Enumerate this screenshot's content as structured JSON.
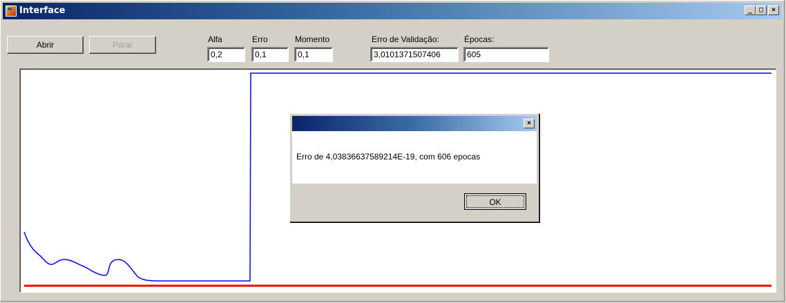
{
  "window": {
    "title": "Interface",
    "controls": {
      "minimize": "_",
      "maximize": "□",
      "close": "×"
    }
  },
  "toolbar": {
    "open_label": "Abrir",
    "stop_label": "Parar"
  },
  "params": {
    "alfa": {
      "label": "Alfa",
      "value": "0,2"
    },
    "erro": {
      "label": "Erro",
      "value": "0,1"
    },
    "momento": {
      "label": "Momento",
      "value": "0,1"
    },
    "erro_validacao": {
      "label": "Erro de Validação:",
      "value": "3,0101371507406"
    },
    "epocas": {
      "label": "Épocas:",
      "value": "605"
    }
  },
  "dialog": {
    "message": "Erro de 4,03836637589214E-19, com 606 epocas",
    "ok_label": "OK",
    "close": "×"
  },
  "colors": {
    "title_start": "#0a246a",
    "title_end": "#a6caf0",
    "error_curve": "#0000ff",
    "target_line": "#ff0000",
    "face": "#d4d0c8"
  }
}
